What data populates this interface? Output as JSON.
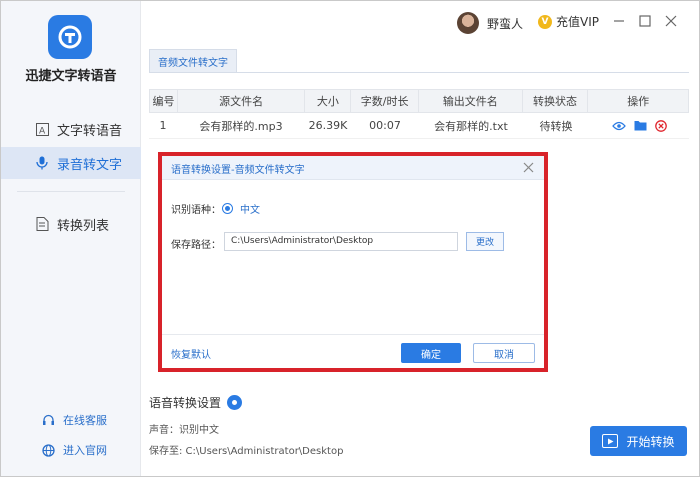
{
  "app": {
    "name": "迅捷文字转语音"
  },
  "sidebar": {
    "items": [
      {
        "label": "文字转语音",
        "icon": "text-a-icon"
      },
      {
        "label": "录音转文字",
        "icon": "microphone-icon"
      },
      {
        "label": "转换列表",
        "icon": "list-icon"
      }
    ],
    "links": [
      {
        "label": "在线客服",
        "icon": "headset-icon"
      },
      {
        "label": "进入官网",
        "icon": "globe-icon"
      }
    ]
  },
  "header": {
    "user_name": "野蛮人",
    "vip_label": "充值VIP"
  },
  "tab": {
    "label": "音频文件转文字"
  },
  "table": {
    "columns": [
      "编号",
      "源文件名",
      "大小",
      "字数/时长",
      "输出文件名",
      "转换状态",
      "操作"
    ],
    "rows": [
      {
        "index": "1",
        "source": "会有那样的.mp3",
        "size": "26.39K",
        "duration": "00:07",
        "output": "会有那样的.txt",
        "status": "待转换"
      }
    ]
  },
  "dialog": {
    "title": "语音转换设置-音频文件转文字",
    "language_label": "识别语种：",
    "language_value": "中文",
    "path_label": "保存路径：",
    "path_value": "C:\\Users\\Administrator\\Desktop",
    "change_label": "更改",
    "restore_label": "恢复默认",
    "ok_label": "确定",
    "cancel_label": "取消"
  },
  "settings": {
    "title": "语音转换设置",
    "voice_line": "声音：识别中文",
    "save_line": "保存至: C:\\Users\\Administrator\\Desktop",
    "start_label": "开始转换"
  },
  "colors": {
    "accent": "#2a7be3",
    "highlight": "#d8232a"
  }
}
